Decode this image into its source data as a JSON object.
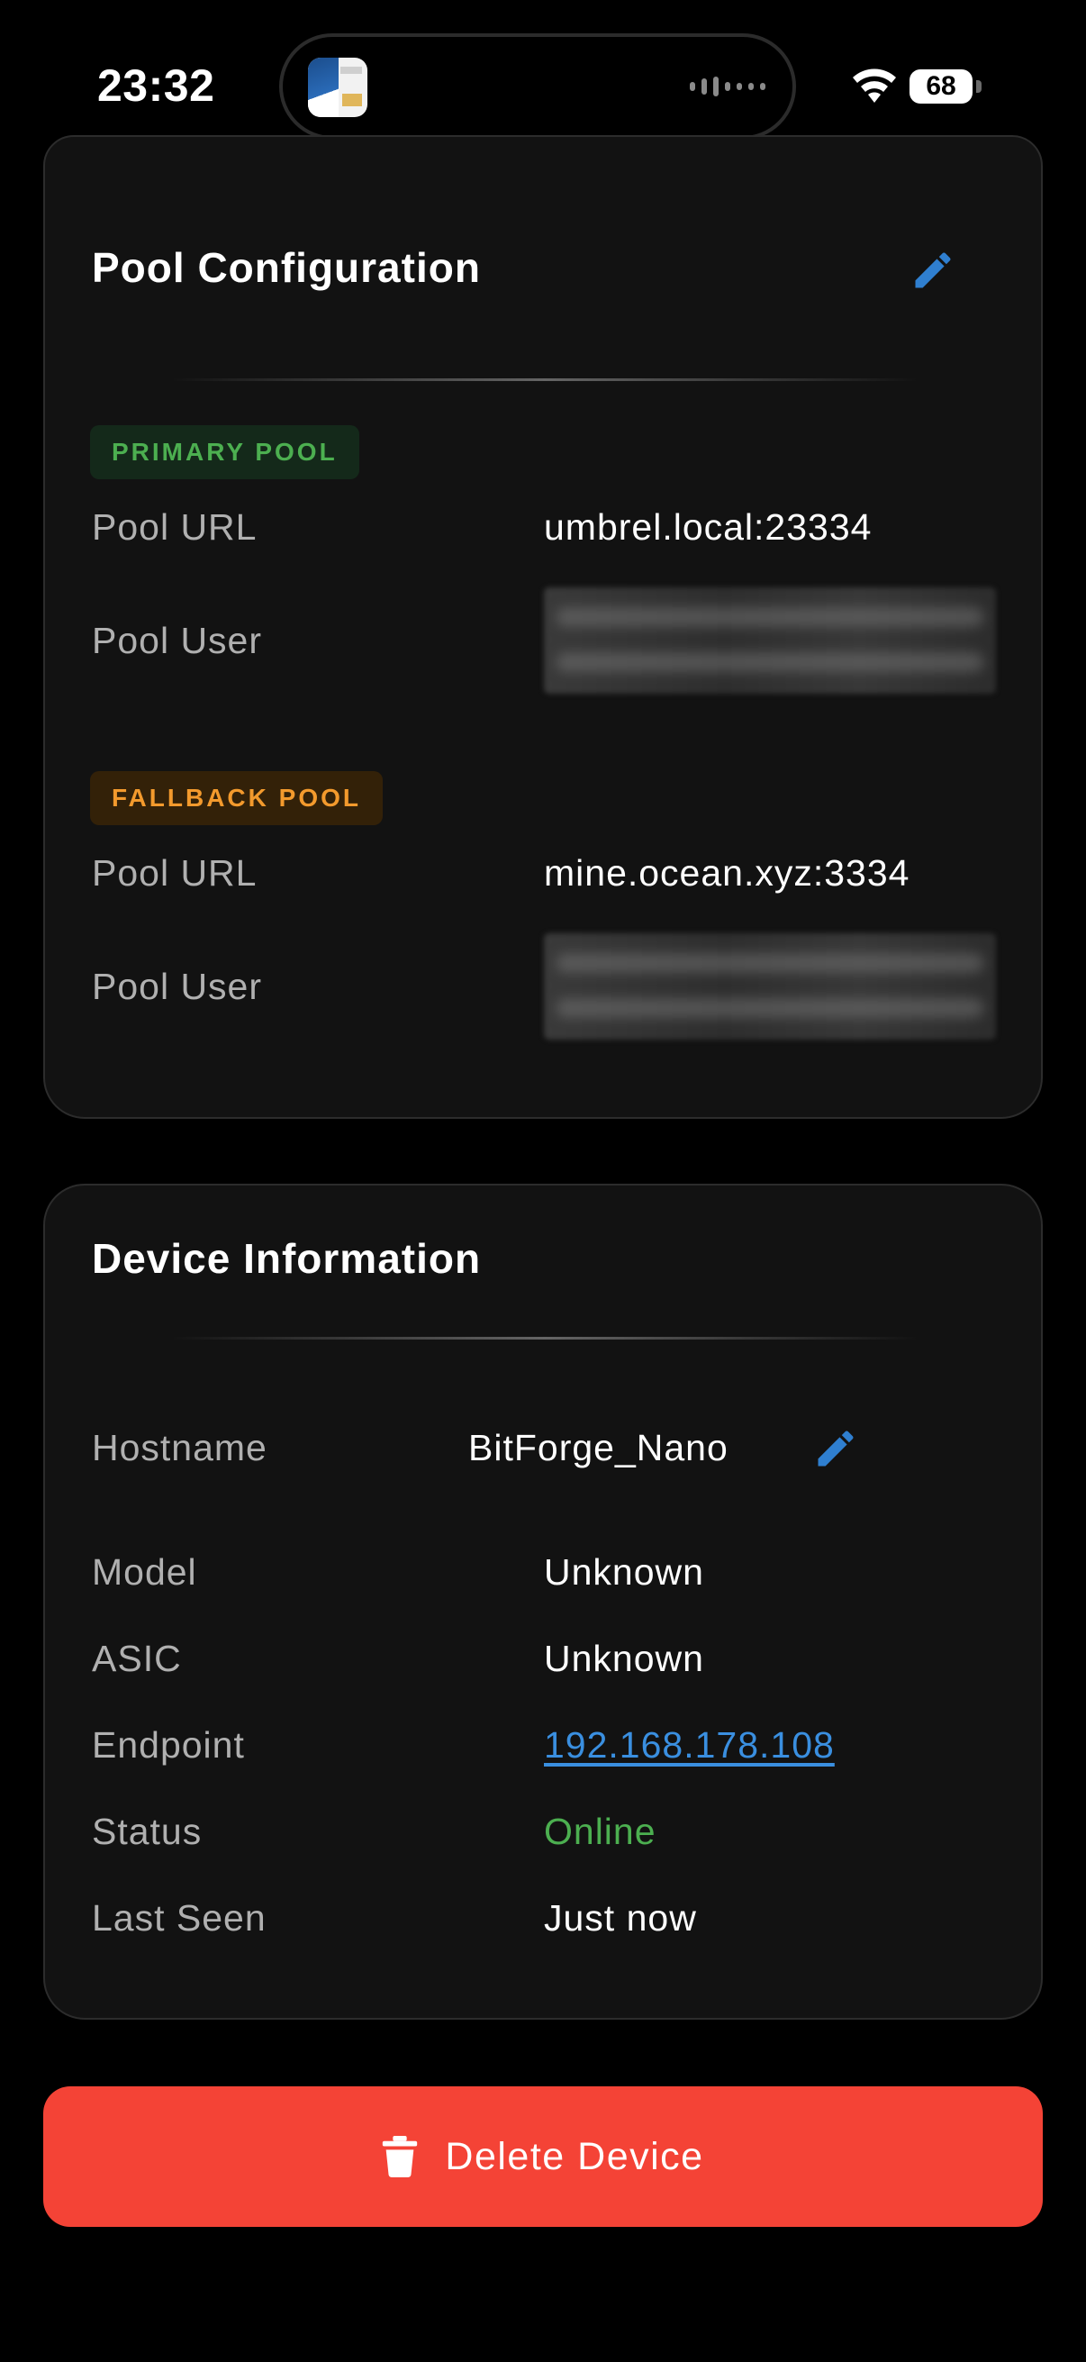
{
  "status_bar": {
    "time": "23:32",
    "battery": "68"
  },
  "pool_configuration": {
    "title": "Pool Configuration",
    "primary": {
      "badge": "PRIMARY POOL",
      "url_label": "Pool URL",
      "url_value": "umbrel.local:23334",
      "user_label": "Pool User"
    },
    "fallback": {
      "badge": "FALLBACK POOL",
      "url_label": "Pool URL",
      "url_value": "mine.ocean.xyz:3334",
      "user_label": "Pool User"
    }
  },
  "device_information": {
    "title": "Device Information",
    "rows": [
      {
        "label": "Hostname",
        "value": "BitForge_Nano"
      },
      {
        "label": "Model",
        "value": "Unknown"
      },
      {
        "label": "ASIC",
        "value": "Unknown"
      },
      {
        "label": "Endpoint",
        "value": "192.168.178.108"
      },
      {
        "label": "Status",
        "value": "Online"
      },
      {
        "label": "Last Seen",
        "value": "Just now"
      }
    ]
  },
  "delete_button": {
    "label": "Delete Device"
  },
  "colors": {
    "accent_blue": "#3a8fe0",
    "online_green": "#4caf50",
    "fallback_orange": "#f39a2d",
    "delete_red": "#f44336",
    "card_bg": "#121212"
  },
  "icons": [
    "wifi-icon",
    "battery-icon",
    "edit-icon",
    "trash-icon"
  ]
}
